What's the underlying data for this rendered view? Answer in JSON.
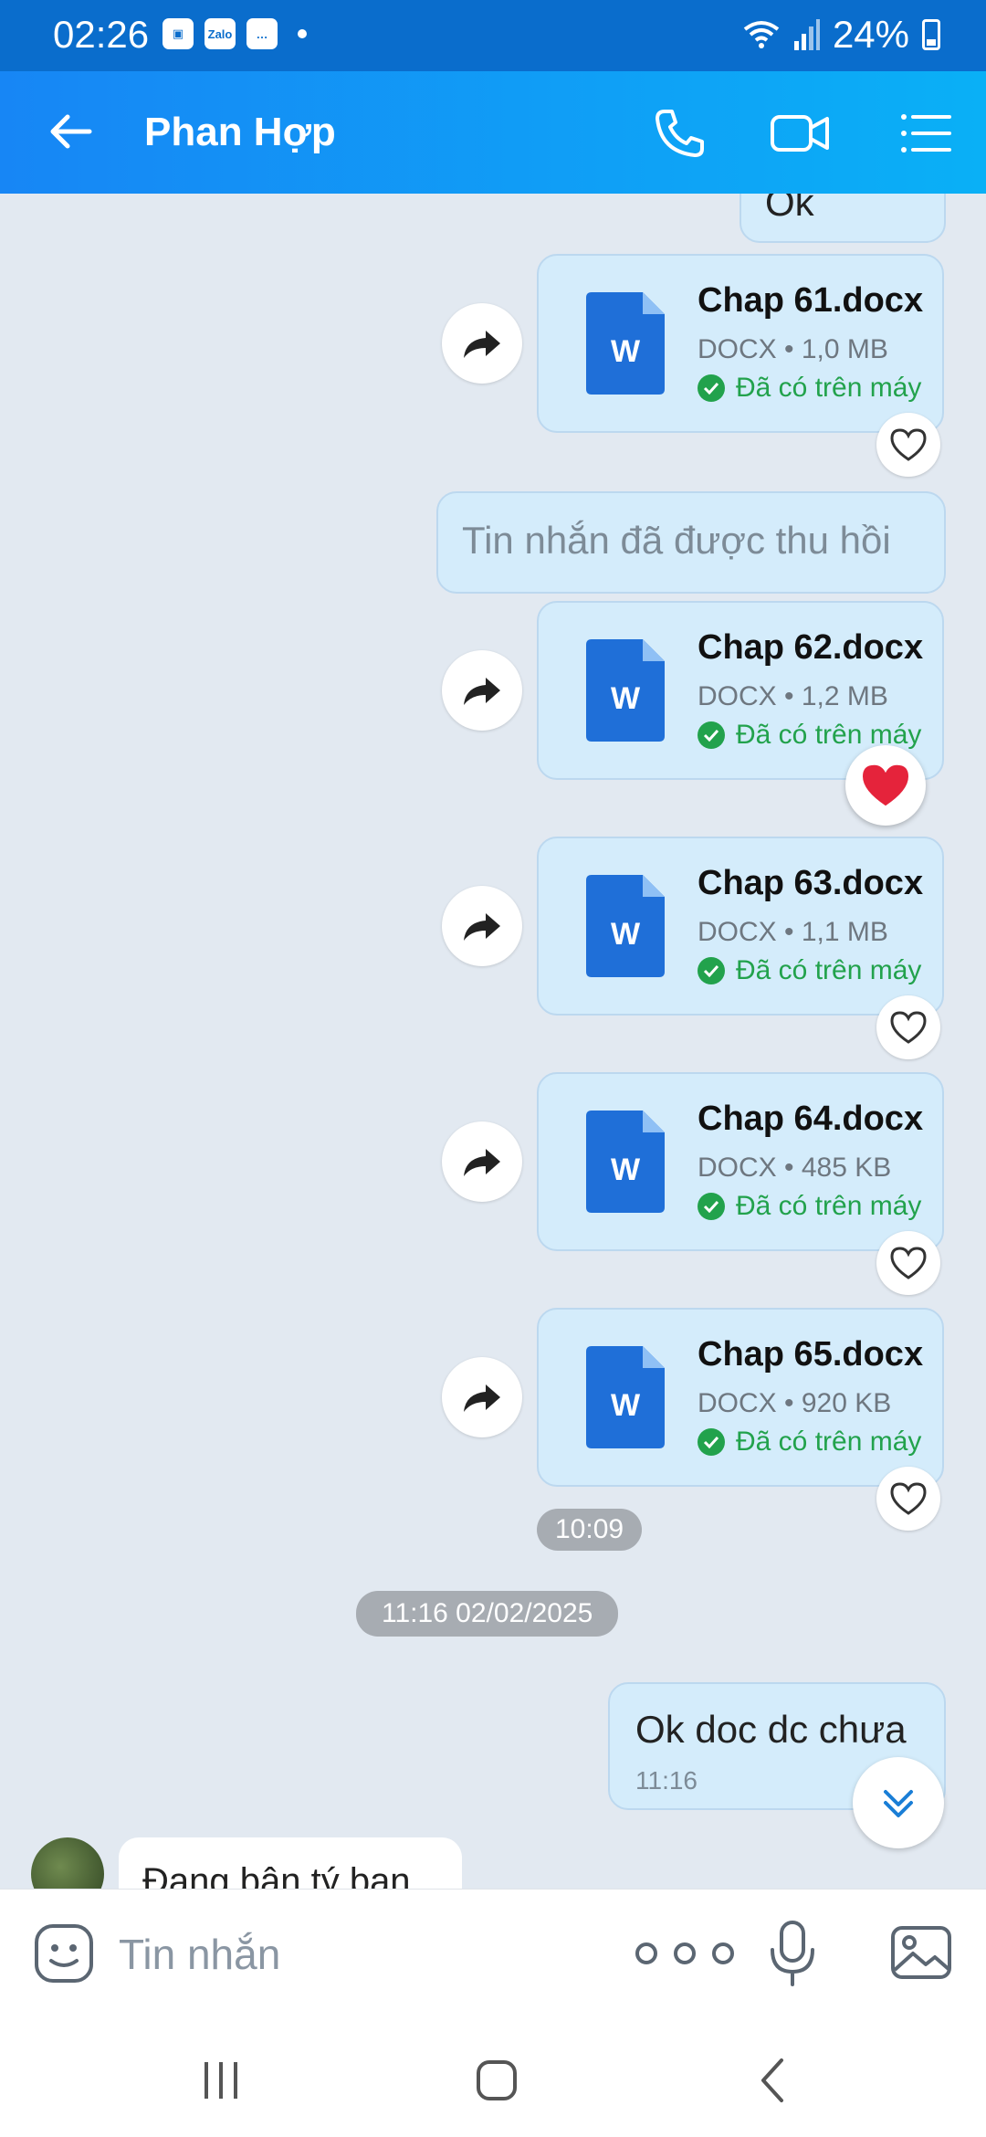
{
  "status_bar": {
    "time": "02:26",
    "battery": "24%"
  },
  "header": {
    "contact_name": "Phan Hợp"
  },
  "messages": {
    "partial_ok": "Ok",
    "recalled": "Tin nhắn đã được thu hồi",
    "files": [
      {
        "name": "Chap 61.docx",
        "meta": "DOCX • 1,0 MB",
        "status": "Đã có trên máy",
        "doc_letter": "W"
      },
      {
        "name": "Chap 62.docx",
        "meta": "DOCX • 1,2 MB",
        "status": "Đã có trên máy",
        "doc_letter": "W"
      },
      {
        "name": "Chap 63.docx",
        "meta": "DOCX • 1,1 MB",
        "status": "Đã có trên máy",
        "doc_letter": "W"
      },
      {
        "name": "Chap 64.docx",
        "meta": "DOCX • 485 KB",
        "status": "Đã có trên máy",
        "doc_letter": "W"
      },
      {
        "name": "Chap 65.docx",
        "meta": "DOCX • 920 KB",
        "status": "Đã có trên máy",
        "doc_letter": "W"
      }
    ],
    "time_1009": "10:09",
    "date_separator": "11:16 02/02/2025",
    "outgoing_text": "Ok doc dc chưa",
    "outgoing_time": "11:16",
    "incoming_text": "Đang bận tý bạn"
  },
  "input": {
    "placeholder": "Tin nhắn"
  },
  "colors": {
    "header_start": "#1786f5",
    "header_end": "#0ab0f6",
    "bubble": "#d4ecfb",
    "downloaded_green": "#22a24c",
    "word_blue": "#1f6fd8"
  },
  "icons": [
    "back-arrow-icon",
    "phone-icon",
    "video-call-icon",
    "menu-list-icon",
    "share-forward-icon",
    "heart-icon",
    "word-doc-icon",
    "check-circle-icon",
    "chevron-double-down-icon",
    "emoji-icon",
    "more-dots-icon",
    "mic-icon",
    "gallery-icon"
  ]
}
